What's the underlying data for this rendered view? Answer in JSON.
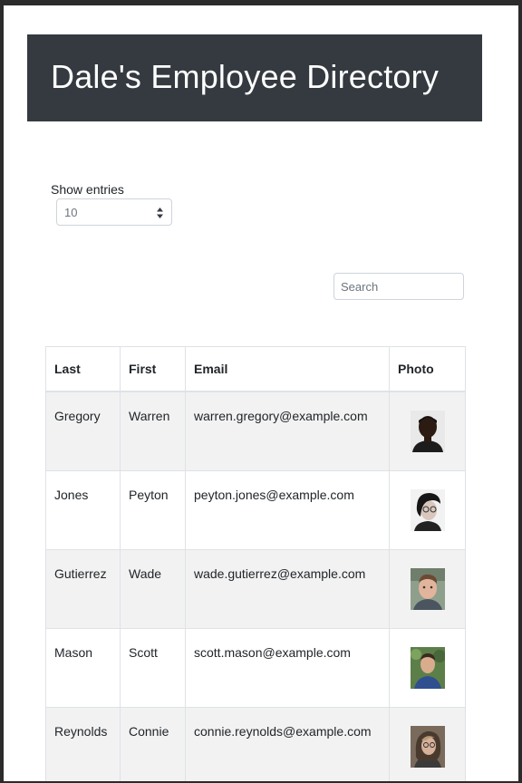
{
  "header": {
    "title": "Dale's Employee Directory"
  },
  "controls": {
    "show_entries_label": "Show entries",
    "entries_selected": "10",
    "search_placeholder": "Search"
  },
  "table": {
    "columns": [
      "Last",
      "First",
      "Email",
      "Photo"
    ],
    "rows": [
      {
        "last": "Gregory",
        "first": "Warren",
        "email": "warren.gregory@example.com",
        "photo": "portrait-warren-gregory"
      },
      {
        "last": "Jones",
        "first": "Peyton",
        "email": "peyton.jones@example.com",
        "photo": "portrait-peyton-jones"
      },
      {
        "last": "Gutierrez",
        "first": "Wade",
        "email": "wade.gutierrez@example.com",
        "photo": "portrait-wade-gutierrez"
      },
      {
        "last": "Mason",
        "first": "Scott",
        "email": "scott.mason@example.com",
        "photo": "portrait-scott-mason"
      },
      {
        "last": "Reynolds",
        "first": "Connie",
        "email": "connie.reynolds@example.com",
        "photo": "portrait-connie-reynolds"
      }
    ]
  },
  "colors": {
    "header_bg": "#343a40",
    "header_text": "#ffffff",
    "striped_row": "#f2f2f2",
    "border": "#dee2e6"
  }
}
